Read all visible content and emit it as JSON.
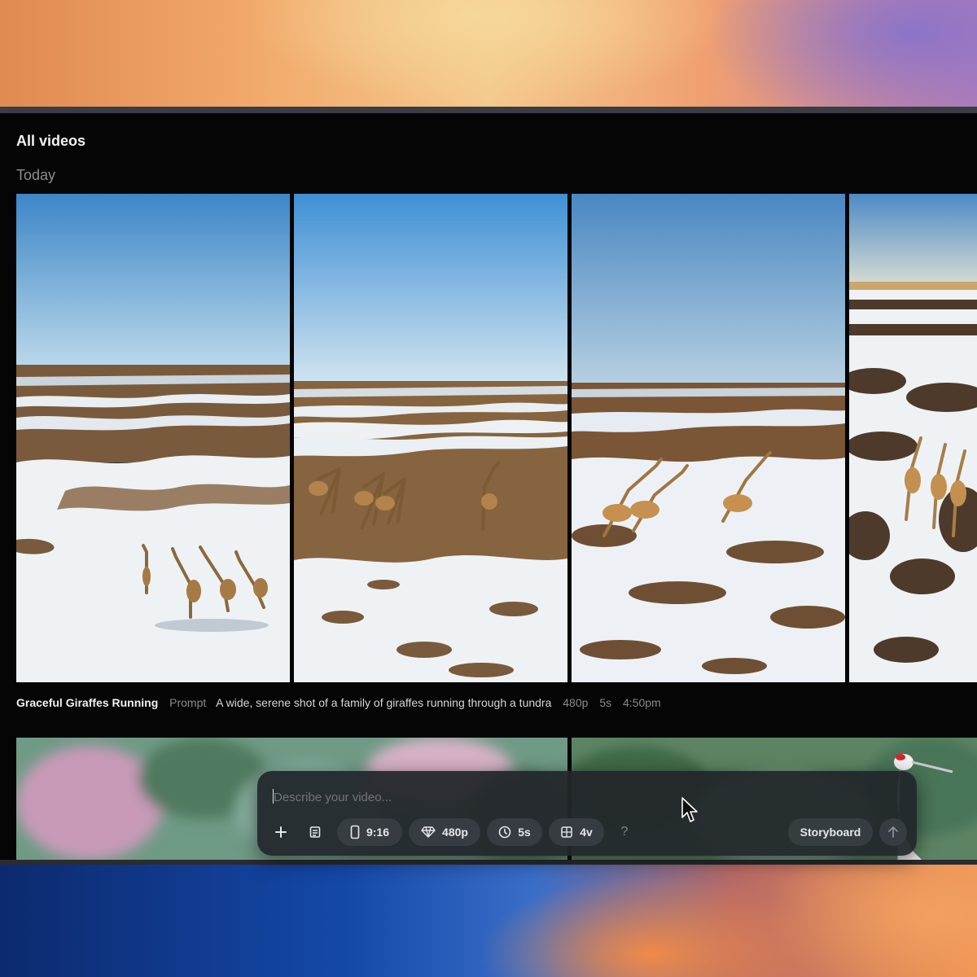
{
  "page": {
    "title": "All videos",
    "section": "Today"
  },
  "videos": [
    {
      "title": "Graceful Giraffes Running",
      "prompt_label": "Prompt",
      "prompt": "A wide, serene shot of a family of giraffes running through a tundra",
      "resolution": "480p",
      "duration": "5s",
      "time": "4:50pm"
    }
  ],
  "composer": {
    "placeholder": "Describe your video...",
    "add_icon": "plus-icon",
    "preset_icon": "document-icon",
    "aspect_icon": "phone-portrait-icon",
    "aspect_label": "9:16",
    "resolution_icon": "diamond-icon",
    "resolution_label": "480p",
    "duration_icon": "clock-icon",
    "duration_label": "5s",
    "variations_icon": "grid-icon",
    "variations_label": "4v",
    "help_label": "?",
    "storyboard_label": "Storyboard",
    "submit_icon": "arrow-up-icon"
  },
  "colors": {
    "window_bg": "#050505",
    "composer_bg": "#22262a",
    "pill_bg": "#3a3f44",
    "text_primary": "#f0f0f0",
    "text_muted": "#8a8a8a"
  }
}
